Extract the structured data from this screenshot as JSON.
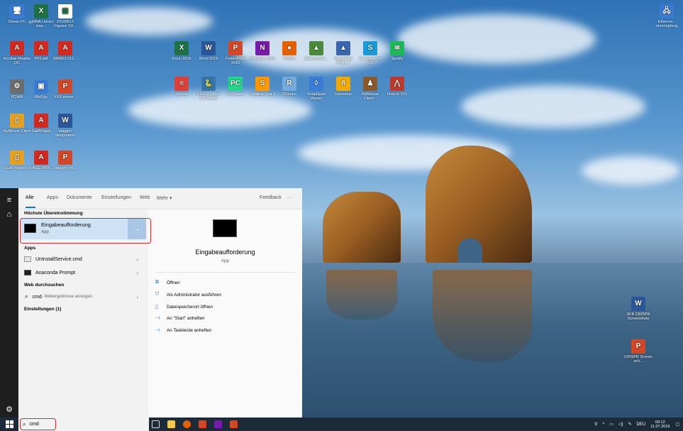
{
  "desktop_icons": [
    {
      "label": "Dieser PC",
      "color": "#3a7bd5",
      "glyph": "🖥"
    },
    {
      "label": "ggNNA Library Han...",
      "color": "#1e7145",
      "glyph": "X"
    },
    {
      "label": "20190612 Figures XX...",
      "color": "#ffffff",
      "glyph": "▦"
    },
    {
      "label": "Acrobat Reader DC",
      "color": "#d4291f",
      "glyph": "A"
    },
    {
      "label": "P03.pdf",
      "color": "#d4291f",
      "glyph": "A"
    },
    {
      "label": "MRB03 013...",
      "color": "#d4291f",
      "glyph": "A"
    },
    {
      "label": "Excel 2016",
      "color": "#1e7145",
      "glyph": "X"
    },
    {
      "label": "Word 2016",
      "color": "#2b579a",
      "glyph": "W"
    },
    {
      "label": "PowerPoint 2016",
      "color": "#d24726",
      "glyph": "P"
    },
    {
      "label": "OneNote 2016",
      "color": "#7719aa",
      "glyph": "N"
    },
    {
      "label": "Firefox",
      "color": "#e66000",
      "glyph": "●"
    },
    {
      "label": "Datenmana...",
      "color": "#4a8a3a",
      "glyph": "▲"
    },
    {
      "label": "GraphPad Prism 7",
      "color": "#3a66b0",
      "glyph": "▲"
    },
    {
      "label": "Compass for SW",
      "color": "#1a9bd7",
      "glyph": "S"
    },
    {
      "label": "Spotify",
      "color": "#1db954",
      "glyph": "≋"
    },
    {
      "label": "PCIAN",
      "color": "#6c6c6c",
      "glyph": "⚙"
    },
    {
      "label": "iBeGgy",
      "color": "#3a7bd5",
      "glyph": "▣"
    },
    {
      "label": "XXX primer...",
      "color": "#d24726",
      "glyph": "P"
    },
    {
      "label": "Todoist",
      "color": "#db4035",
      "glyph": "≡"
    },
    {
      "label": "IDLE (Python 3.6 64-bit)",
      "color": "#3776ab",
      "glyph": "🐍"
    },
    {
      "label": "PyCharm",
      "color": "#21d789",
      "glyph": "PC"
    },
    {
      "label": "Sublime Text 3",
      "color": "#ff9800",
      "glyph": "S"
    },
    {
      "label": "RStudio",
      "color": "#75aadb",
      "glyph": "R"
    },
    {
      "label": "SnapGene Viewer",
      "color": "#3a7bd5",
      "glyph": "◊"
    },
    {
      "label": "Geneious",
      "color": "#f2a900",
      "glyph": "8"
    },
    {
      "label": "MyMouse Client...",
      "color": "#8a5a2a",
      "glyph": "♟"
    },
    {
      "label": "FlowJo V10",
      "color": "#c0392b",
      "glyph": "⋀"
    },
    {
      "label": "MyMouse Client",
      "color": "#e6a020",
      "glyph": "▯"
    },
    {
      "label": "DatAPapel",
      "color": "#d4291f",
      "glyph": "A"
    },
    {
      "label": "stagger designation",
      "color": "#2b579a",
      "glyph": "W"
    },
    {
      "label": "FLab Papers...",
      "color": "#e6a020",
      "glyph": "▯"
    },
    {
      "label": "F-AGE-0000...",
      "color": "#d4291f",
      "glyph": "A"
    },
    {
      "label": "stagger_str...",
      "color": "#d24726",
      "glyph": "P"
    },
    {
      "label": "Ethernet - Verknüpfung",
      "color": "#3a7bd5",
      "glyph": "🖧"
    },
    {
      "label": "SFB CRISPR Screenshots",
      "color": "#2b579a",
      "glyph": "W"
    },
    {
      "label": "CRISPR Screen sch...",
      "color": "#d24726",
      "glyph": "P"
    }
  ],
  "start": {
    "tabs": [
      "Alle",
      "Apps",
      "Dokumente",
      "Einstellungen",
      "Web",
      "Mehr ▾"
    ],
    "feedback": "Feedback",
    "more_dots": "···",
    "best_match_header": "Höchste Übereinstimmung",
    "best_match": {
      "title": "Eingabeaufforderung",
      "subtitle": "App",
      "arrow": "→"
    },
    "apps_header": "Apps",
    "apps": [
      {
        "label": "UnInstallService.cmd"
      },
      {
        "label": "Anaconda Prompt"
      }
    ],
    "web_header": "Web durchsuchen",
    "web_item": {
      "query": "cmd",
      "suffix": " - Webergebnisse anzeigen"
    },
    "settings_header": "Einstellungen (1)",
    "preview": {
      "title": "Eingabeaufforderung",
      "subtitle": "App",
      "actions": [
        {
          "icon": "open-icon",
          "glyph": "⧉",
          "label": "Öffnen"
        },
        {
          "icon": "admin-icon",
          "glyph": "⛉",
          "label": "Als Administrator ausführen"
        },
        {
          "icon": "folder-icon",
          "glyph": "▯",
          "label": "Dateispeicherort öffnen"
        },
        {
          "icon": "pin-icon",
          "glyph": "⊣",
          "label": "An \"Start\" anheften"
        },
        {
          "icon": "pin-icon",
          "glyph": "⊣",
          "label": "An Taskleiste anheften"
        }
      ]
    }
  },
  "taskbar": {
    "search_value": "cmd",
    "language": "DEU",
    "time": "09:12",
    "date": "11.07.2019"
  },
  "colors": {
    "accent": "#0078d7",
    "highlight_box": "#d42b2b"
  }
}
